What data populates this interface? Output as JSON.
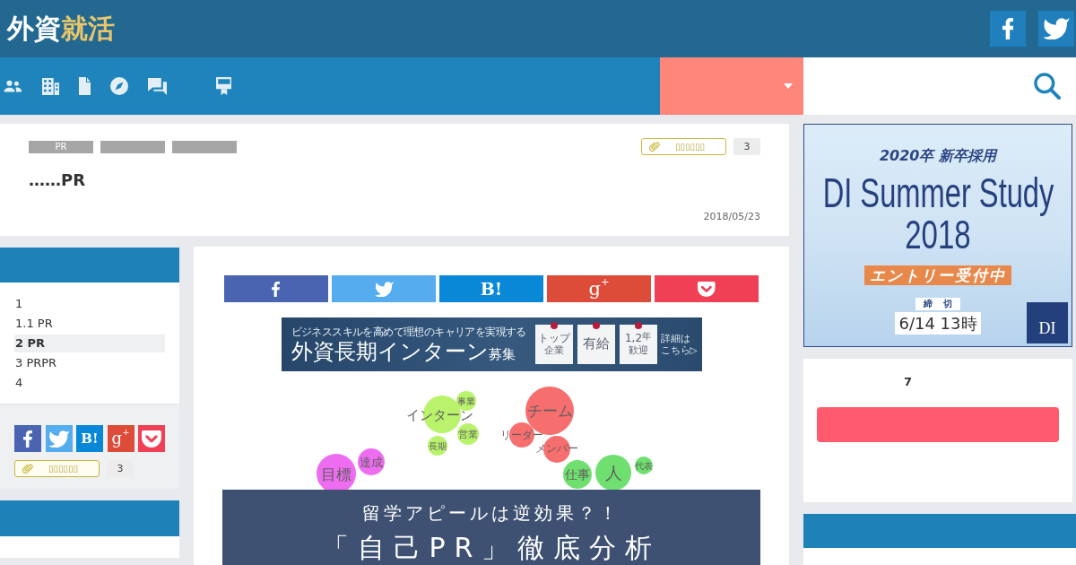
{
  "header": {
    "logo": "外資",
    "logo_accent": "就活",
    "social": [
      {
        "kind": "facebook"
      },
      {
        "kind": "twitter"
      }
    ]
  },
  "nav": {
    "icons": [
      {
        "kind": "people"
      },
      {
        "kind": "building"
      },
      {
        "kind": "document"
      },
      {
        "kind": "compass"
      },
      {
        "kind": "chat"
      },
      {
        "kind": "board"
      }
    ]
  },
  "article": {
    "tags": [
      {
        "kind": "text",
        "label": "PR"
      },
      {
        "kind": "blank"
      },
      {
        "kind": "blank"
      }
    ],
    "clip": {
      "label": "▯▯▯▯▯▯",
      "count": "3"
    },
    "title": "……PR",
    "date": "2018/05/23"
  },
  "toc": {
    "items": [
      {
        "label": "1",
        "selected": false
      },
      {
        "label": "1.1 PR",
        "selected": false
      },
      {
        "label": "2 PR",
        "selected": true
      },
      {
        "label": "3 PRPR",
        "selected": false
      },
      {
        "label": "4",
        "selected": false
      }
    ]
  },
  "side_share": {
    "buttons": [
      {
        "kind": "facebook"
      },
      {
        "kind": "twitter"
      },
      {
        "kind": "hatena",
        "label": "B!"
      },
      {
        "kind": "gplus",
        "label": "g$^{+}$"
      },
      {
        "kind": "pocket"
      }
    ],
    "clip": {
      "label": "▯▯▯▯▯▯",
      "count": "3"
    }
  },
  "share_bar": {
    "buttons": [
      {
        "kind": "facebook"
      },
      {
        "kind": "twitter"
      },
      {
        "kind": "hatena",
        "label": "B!"
      },
      {
        "kind": "gplus",
        "label": "g$^{+}$"
      },
      {
        "kind": "pocket"
      }
    ]
  },
  "intern_banner": {
    "tagline": "ビジネススキルを高めて理想のキャリアを実現する",
    "headline": "外資長期インターン$_{募集}$",
    "cards": [
      {
        "lines": [
          "トップ",
          "企業"
        ]
      },
      {
        "lines": [
          "有給"
        ]
      },
      {
        "lines": [
          "1,2$^{年}$",
          "歓迎"
        ]
      }
    ],
    "more": [
      "詳細は",
      "こちら▷"
    ]
  },
  "eyecatch": {
    "words": [
      {
        "text": "事業",
        "color": "#b9f36c"
      },
      {
        "text": "チーム",
        "color": "#f76e6e"
      },
      {
        "text": "インターン",
        "color": "#b9f36c"
      },
      {
        "text": "営業",
        "color": "#b9f36c"
      },
      {
        "text": "リーダー",
        "color": "#f76e6e"
      },
      {
        "text": "長期",
        "color": "#b9f36c"
      },
      {
        "text": "メンバー",
        "color": "#f76e6e"
      },
      {
        "text": "達成",
        "color": "#ee6cf0"
      },
      {
        "text": "代表",
        "color": "#6fe06f"
      },
      {
        "text": "目標",
        "color": "#ee6cf0"
      },
      {
        "text": "仕事",
        "color": "#6fe06f"
      },
      {
        "text": "人",
        "color": "#6fe06f"
      }
    ],
    "overlay": [
      "留学アピールは逆効果？！",
      "「自己PR」徹底分析"
    ]
  },
  "ad": {
    "subtitle": "2020卒 新卒採用",
    "title": "DI Summer Study",
    "year": "2018",
    "entry": "エントリー受付中",
    "deadline_label": "締 切",
    "deadline": "6/14 13時",
    "logo": "DI"
  },
  "widget": {
    "heading": "7"
  }
}
